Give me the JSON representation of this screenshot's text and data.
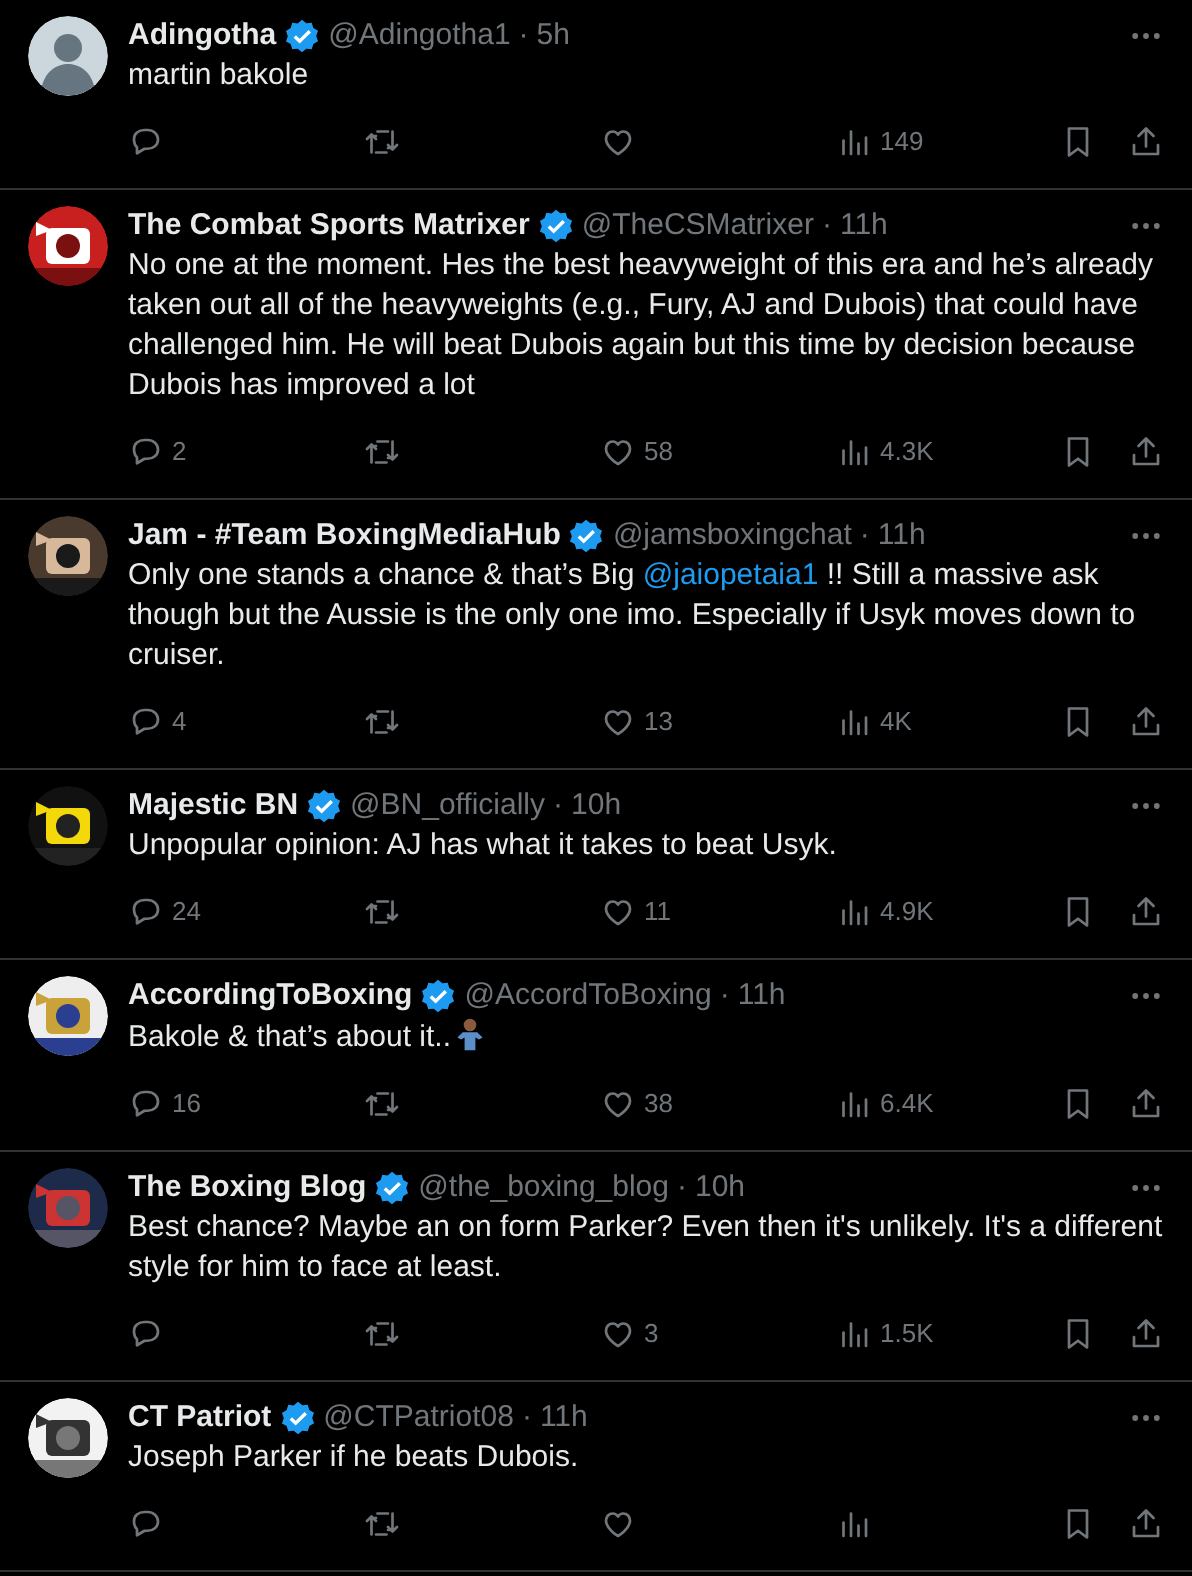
{
  "posts": [
    {
      "name": "Adingotha",
      "verified": true,
      "handle": "@Adingotha1",
      "dot": "·",
      "time": "5h",
      "avatar": {
        "kind": "default"
      },
      "text": [
        {
          "kind": "text",
          "text": "martin bakole"
        }
      ],
      "stats": {
        "views": "149"
      }
    },
    {
      "name": "The Combat Sports Matrixer",
      "verified": true,
      "handle": "@TheCSMatrixer",
      "dot": "·",
      "time": "11h",
      "avatar": {
        "kind": "picture"
      },
      "text": [
        {
          "kind": "text",
          "text": "No one at the moment. Hes the best heavyweight of this era and he’s already taken out all of the heavyweights (e.g., Fury, AJ and Dubois) that could have challenged him. He will beat Dubois again but this time by decision because Dubois has improved a lot"
        }
      ],
      "stats": {
        "replies": "2",
        "likes": "58",
        "views": "4.3K"
      }
    },
    {
      "name": "Jam - #Team BoxingMediaHub",
      "verified": true,
      "handle": "@jamsboxingchat",
      "dot": "·",
      "time": "11h",
      "avatar": {
        "kind": "picture"
      },
      "text": [
        {
          "kind": "text",
          "text": "Only one stands a chance & that’s Big "
        },
        {
          "kind": "mention",
          "text": "@jaiopetaia1"
        },
        {
          "kind": "text",
          "text": " !! Still a massive ask though but the Aussie is the only one imo. Especially if Usyk moves down to cruiser."
        }
      ],
      "stats": {
        "replies": "4",
        "likes": "13",
        "views": "4K"
      }
    },
    {
      "name": "Majestic BN",
      "verified": true,
      "handle": "@BN_officially",
      "dot": "·",
      "time": "10h",
      "avatar": {
        "kind": "picture"
      },
      "text": [
        {
          "kind": "text",
          "text": "Unpopular opinion: AJ has what it takes to beat Usyk."
        }
      ],
      "stats": {
        "replies": "24",
        "likes": "11",
        "views": "4.9K"
      }
    },
    {
      "name": "AccordingToBoxing",
      "verified": true,
      "handle": "@AccordToBoxing",
      "dot": "·",
      "time": "11h",
      "avatar": {
        "kind": "picture"
      },
      "text": [
        {
          "kind": "text",
          "text": "Bakole & that’s about it.."
        },
        {
          "kind": "shrug"
        }
      ],
      "stats": {
        "replies": "16",
        "likes": "38",
        "views": "6.4K"
      }
    },
    {
      "name": "The Boxing Blog",
      "verified": true,
      "handle": "@the_boxing_blog",
      "dot": "·",
      "time": "10h",
      "avatar": {
        "kind": "picture"
      },
      "text": [
        {
          "kind": "text",
          "text": "Best chance? Maybe an on form Parker? Even then it's unlikely. It's a different style for him to face at least."
        }
      ],
      "stats": {
        "likes": "3",
        "views": "1.5K"
      }
    },
    {
      "name": "CT Patriot",
      "verified": true,
      "handle": "@CTPatriot08",
      "dot": "·",
      "time": "11h",
      "avatar": {
        "kind": "picture"
      },
      "text": [
        {
          "kind": "text",
          "text": "Joseph Parker if he beats Dubois."
        }
      ]
    }
  ]
}
